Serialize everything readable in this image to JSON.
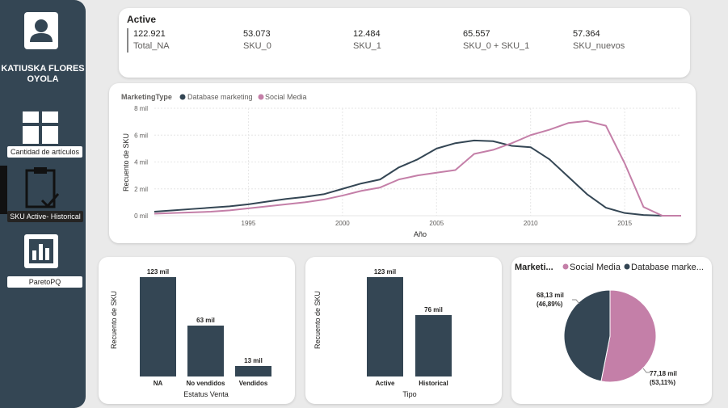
{
  "sidebar": {
    "user_name": "KATIUSKA FLORES OYOLA",
    "nav": [
      {
        "label": "Cantidad de artículos",
        "icon": "grid-icon"
      },
      {
        "label": "SKU Active- Historical",
        "icon": "clipboard-check-icon",
        "active": true
      },
      {
        "label": "ParetoPQ",
        "icon": "bar-chart-icon"
      }
    ]
  },
  "kpi": {
    "title": "Active",
    "items": [
      {
        "value": "122.921",
        "label": "Total_NA"
      },
      {
        "value": "53.073",
        "label": "SKU_0"
      },
      {
        "value": "12.484",
        "label": "SKU_1"
      },
      {
        "value": "65.557",
        "label": "SKU_0 + SKU_1"
      },
      {
        "value": "57.364",
        "label": "SKU_nuevos"
      }
    ]
  },
  "colors": {
    "dark": "#344654",
    "pink": "#c47fa8"
  },
  "chart_data": [
    {
      "type": "line",
      "legend_title": "MarketingType",
      "xlabel": "Año",
      "ylabel": "Recuento de SKU",
      "y_ticks": [
        "0 mil",
        "2 mil",
        "4 mil",
        "6 mil",
        "8 mil"
      ],
      "x_ticks": [
        "1995",
        "2000",
        "2005",
        "2010",
        "2015"
      ],
      "xlim": [
        1990,
        2018
      ],
      "ylim": [
        0,
        8
      ],
      "x": [
        1990,
        1991,
        1992,
        1993,
        1994,
        1995,
        1996,
        1997,
        1998,
        1999,
        2000,
        2001,
        2002,
        2003,
        2004,
        2005,
        2006,
        2007,
        2008,
        2009,
        2010,
        2011,
        2012,
        2013,
        2014,
        2015,
        2016,
        2017,
        2018
      ],
      "series": [
        {
          "name": "Database marketing",
          "color": "#344654",
          "values": [
            0.3,
            0.4,
            0.5,
            0.6,
            0.7,
            0.85,
            1.05,
            1.25,
            1.4,
            1.6,
            2.0,
            2.4,
            2.7,
            3.6,
            4.2,
            5.0,
            5.4,
            5.6,
            5.55,
            5.2,
            5.1,
            4.2,
            2.9,
            1.6,
            0.6,
            0.2,
            0.05,
            0.0,
            0.0
          ]
        },
        {
          "name": "Social Media",
          "color": "#c47fa8",
          "values": [
            0.15,
            0.2,
            0.25,
            0.3,
            0.4,
            0.55,
            0.7,
            0.85,
            1.0,
            1.2,
            1.5,
            1.85,
            2.1,
            2.7,
            3.0,
            3.2,
            3.4,
            4.6,
            4.9,
            5.4,
            6.0,
            6.4,
            6.9,
            7.05,
            6.7,
            3.9,
            0.65,
            0.0,
            0.0
          ]
        }
      ]
    },
    {
      "type": "bar",
      "xlabel": "Estatus Venta",
      "ylabel": "Recuento de SKU",
      "categories": [
        "NA",
        "No vendidos",
        "Vendidos"
      ],
      "values": [
        123,
        63,
        13
      ],
      "value_labels": [
        "123 mil",
        "63 mil",
        "13 mil"
      ],
      "ylim": [
        0,
        123
      ]
    },
    {
      "type": "bar",
      "xlabel": "Tipo",
      "ylabel": "Recuento de SKU",
      "categories": [
        "Active",
        "Historical"
      ],
      "values": [
        123,
        76
      ],
      "value_labels": [
        "123 mil",
        "76 mil"
      ],
      "ylim": [
        0,
        123
      ]
    },
    {
      "type": "pie",
      "legend_title": "Marketi...",
      "slices": [
        {
          "name": "Social Media",
          "value": 77.18,
          "label": "77,18 mil",
          "pct": "(53,11%)",
          "color": "#c47fa8"
        },
        {
          "name": "Database marke...",
          "value": 68.13,
          "label": "68,13 mil",
          "pct": "(46,89%)",
          "color": "#344654"
        }
      ]
    }
  ]
}
